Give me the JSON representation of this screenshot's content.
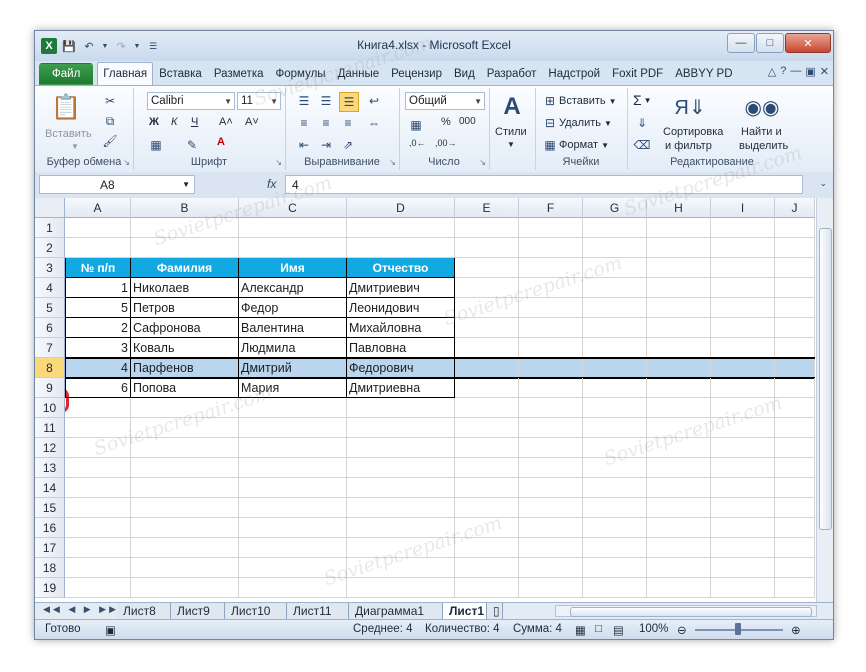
{
  "window": {
    "title": "Книга4.xlsx - Microsoft Excel"
  },
  "tabs": [
    "Файл",
    "Главная",
    "Вставка",
    "Разметка",
    "Формулы",
    "Данные",
    "Рецензир",
    "Вид",
    "Разработ",
    "Надстрой",
    "Foxit PDF",
    "ABBYY PD"
  ],
  "ribbon": {
    "clipboard": {
      "paste": "Вставить",
      "label": "Буфер обмена"
    },
    "font": {
      "name": "Calibri",
      "size": "11",
      "bold": "Ж",
      "italic": "К",
      "underline": "Ч",
      "label": "Шрифт"
    },
    "alignment": {
      "label": "Выравнивание"
    },
    "number": {
      "format": "Общий",
      "percent": "%",
      "thousands": "000",
      "label": "Число"
    },
    "styles": {
      "button": "Стили"
    },
    "cells": {
      "insert": "Вставить",
      "delete": "Удалить",
      "format": "Формат",
      "label": "Ячейки"
    },
    "editing": {
      "sort": "Сортировка\nи фильтр",
      "sort1": "Сортировка",
      "sort2": "и фильтр",
      "find1": "Найти и",
      "find2": "выделить",
      "label": "Редактирование"
    }
  },
  "formula_bar": {
    "name_box": "A8",
    "fx": "fx",
    "value": "4"
  },
  "columns": [
    "A",
    "B",
    "C",
    "D",
    "E",
    "F",
    "G",
    "H",
    "I",
    "J"
  ],
  "rows": [
    "1",
    "2",
    "3",
    "4",
    "5",
    "6",
    "7",
    "8",
    "9",
    "10",
    "11",
    "12",
    "13",
    "14",
    "15",
    "16",
    "17",
    "18",
    "19"
  ],
  "table": {
    "headers": [
      "№ п/п",
      "Фамилия",
      "Имя",
      "Отчество"
    ],
    "rows": [
      [
        "1",
        "Николаев",
        "Александр",
        "Дмитриевич"
      ],
      [
        "5",
        "Петров",
        "Федор",
        "Леонидович"
      ],
      [
        "2",
        "Сафронова",
        "Валентина",
        "Михайловна"
      ],
      [
        "3",
        "Коваль",
        "Людмила",
        "Павловна"
      ],
      [
        "4",
        "Парфенов",
        "Дмитрий",
        "Федорович"
      ],
      [
        "6",
        "Попова",
        "Мария",
        "Дмитриевна"
      ]
    ]
  },
  "selected_row": "8",
  "sheets": [
    "Лист8",
    "Лист9",
    "Лист10",
    "Лист11",
    "Диаграмма1",
    "Лист1"
  ],
  "active_sheet": "Лист1",
  "status": {
    "ready": "Готово",
    "average": "Среднее: 4",
    "count": "Количество: 4",
    "sum": "Сумма: 4",
    "zoom": "100%"
  },
  "watermark": "Sovietpcrepair.com",
  "colors": {
    "header_fill": "#12a9e2",
    "selection": "#bad5ee",
    "highlight_ring": "#e0262b",
    "file_tab": "#1f7a30"
  }
}
